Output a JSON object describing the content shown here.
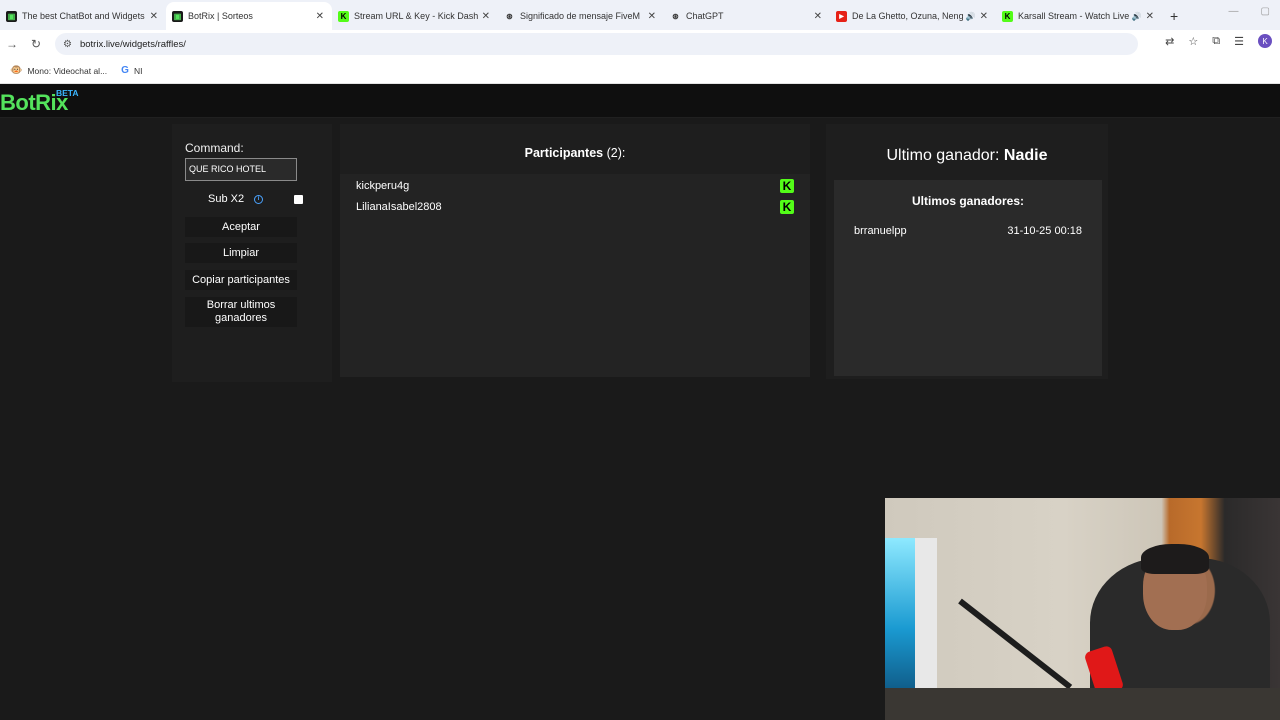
{
  "browser": {
    "tabs": [
      {
        "title": "The best ChatBot and Widgets",
        "favicon": "botrix-icon",
        "active": false,
        "audio": false
      },
      {
        "title": "BotRix | Sorteos",
        "favicon": "botrix-icon",
        "active": true,
        "audio": false
      },
      {
        "title": "Stream URL & Key - Kick Dashb",
        "favicon": "kick-icon",
        "active": false,
        "audio": false
      },
      {
        "title": "Significado de mensaje FiveM",
        "favicon": "chatgpt-icon",
        "active": false,
        "audio": false
      },
      {
        "title": "ChatGPT",
        "favicon": "chatgpt-icon",
        "active": false,
        "audio": false
      },
      {
        "title": "De La Ghetto, Ozuna, Neng",
        "favicon": "youtube-icon",
        "active": false,
        "audio": true
      },
      {
        "title": "Karsall Stream - Watch Live",
        "favicon": "kick-icon",
        "active": false,
        "audio": true
      }
    ],
    "url": "botrix.live/widgets/raffles/",
    "bookmarks": [
      {
        "label": "Mono: Videochat al...",
        "icon": "monkey-icon"
      },
      {
        "label": "NI",
        "icon": "google-icon"
      }
    ],
    "profile_initial": "K"
  },
  "site": {
    "logo": "BotRix",
    "beta": "BETA"
  },
  "controls": {
    "command_label": "Command:",
    "command_value": "QUE RICO HOTEL",
    "sub_label": "Sub X2",
    "sub_checked": false,
    "buttons": {
      "accept": "Aceptar",
      "clear": "Limpiar",
      "copy": "Copiar participantes",
      "delete_winners": "Borrar ultimos ganadores"
    }
  },
  "participants": {
    "title": "Participantes",
    "count": "(2):",
    "list": [
      {
        "name": "kickperu4g",
        "platform": "kick"
      },
      {
        "name": "LilianaIsabel2808",
        "platform": "kick"
      }
    ]
  },
  "winners": {
    "last_label": "Ultimo ganador:",
    "last_value": "Nadie",
    "title": "Ultimos ganadores:",
    "list": [
      {
        "name": "brranuelpp",
        "date": "31-10-25 00:18"
      }
    ]
  },
  "colors": {
    "accent_green": "#53fc18",
    "logo_green": "#54e35c",
    "beta_blue": "#3bb6ff",
    "page_bg": "#1a1a1a"
  }
}
